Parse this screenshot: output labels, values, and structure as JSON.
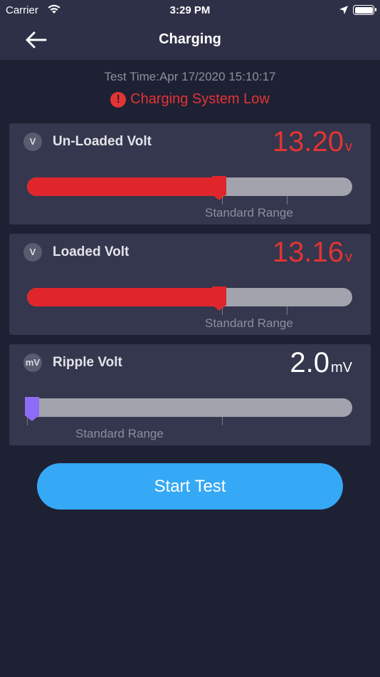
{
  "status_bar": {
    "carrier": "Carrier",
    "time": "3:29 PM"
  },
  "nav": {
    "title": "Charging"
  },
  "test_time": "Test Time:Apr 17/2020 15:10:17",
  "alert": {
    "icon": "!",
    "text": "Charging System Low"
  },
  "cards": [
    {
      "icon": "V",
      "label": "Un-Loaded Volt",
      "value": "13.20",
      "unit": "v",
      "range_label": "Standard Range",
      "fill_fraction": 0.59
    },
    {
      "icon": "V",
      "label": "Loaded Volt",
      "value": "13.16",
      "unit": "v",
      "range_label": "Standard Range",
      "fill_fraction": 0.59
    },
    {
      "icon": "mV",
      "label": "Ripple Volt",
      "value": "2.0",
      "unit": "mV",
      "range_label": "Standard Range",
      "fill_fraction": 0.0
    }
  ],
  "start_button": {
    "label": "Start Test"
  },
  "colors": {
    "accent": "#35a8f6",
    "alert": "#e33434",
    "background": "#1e2034",
    "card": "#34374d"
  }
}
